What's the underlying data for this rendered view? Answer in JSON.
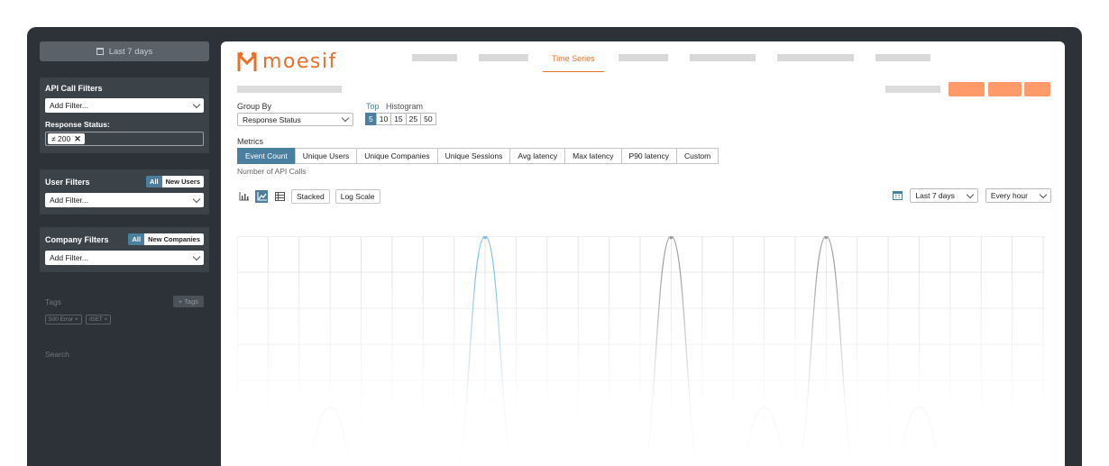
{
  "sidebar": {
    "date_range": "Last 7 days",
    "api_filters": {
      "title": "API Call Filters",
      "add_filter": "Add Filter...",
      "response_status_label": "Response Status:",
      "chip": "≠ 200",
      "chip_remove": "✕"
    },
    "user_filters": {
      "title": "User Filters",
      "all": "All",
      "new": "New Users",
      "add_filter": "Add Filter..."
    },
    "company_filters": {
      "title": "Company Filters",
      "all": "All",
      "new": "New Companies",
      "add_filter": "Add Filter..."
    },
    "tags": {
      "title": "Tags",
      "add": "+ Tags",
      "items": [
        "500 Error ×",
        "/GET ×"
      ]
    },
    "search_label": "Search"
  },
  "header": {
    "logo_text": "moesif",
    "active_tab": "Time Series"
  },
  "controls": {
    "group_by_label": "Group By",
    "group_by_value": "Response Status",
    "top_label": "Top",
    "histogram_label": "Histogram",
    "top_options": [
      "5",
      "10",
      "15",
      "25",
      "50"
    ],
    "metrics_label": "Metrics",
    "metrics": [
      "Event Count",
      "Unique Users",
      "Unique Companies",
      "Unique Sessions",
      "Avg latency",
      "Max latency",
      "P90 latency",
      "Custom"
    ],
    "metric_sub": "Number of API Calls",
    "stacked": "Stacked",
    "log_scale": "Log Scale",
    "range": "Last 7 days",
    "interval": "Every hour"
  },
  "colors": {
    "accent": "#e8702a",
    "button_orange": "#ff9a6a",
    "selected_blue": "#4a7fa0",
    "series_blue": "#7fbfe6",
    "series_gray": "#9aa0a6",
    "grid": "#e6e6e6"
  },
  "chart_data": {
    "type": "line",
    "grid": true,
    "series": [
      {
        "values": [
          0,
          0,
          0,
          0,
          0,
          0,
          0,
          0,
          1,
          0,
          0,
          0,
          0,
          0,
          0,
          0,
          0,
          0,
          0,
          0,
          0,
          0,
          0,
          0,
          0,
          0,
          0
        ]
      },
      {
        "values": [
          0,
          0,
          0,
          0,
          0,
          0,
          0,
          0,
          0,
          0,
          0,
          0,
          0,
          0,
          1,
          0,
          0,
          0,
          0,
          1,
          0,
          0,
          0,
          0,
          0,
          0,
          0
        ]
      },
      {
        "values": [
          0,
          0,
          0,
          0.28,
          0,
          0,
          0,
          0,
          0,
          0,
          0,
          0,
          0,
          0,
          0,
          0,
          0,
          0.28,
          0,
          0,
          0,
          0,
          0.28,
          0,
          0,
          0,
          0
        ]
      }
    ]
  }
}
